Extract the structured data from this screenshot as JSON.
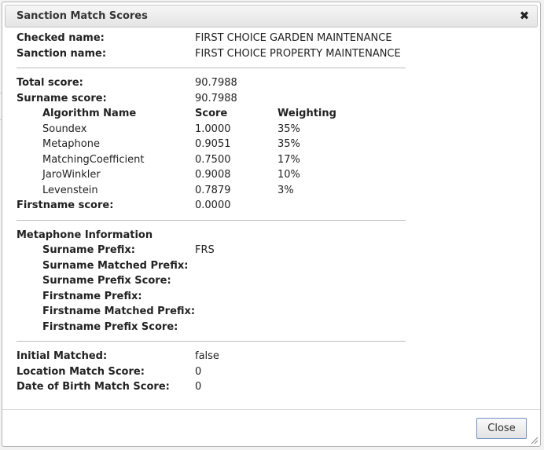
{
  "dialog": {
    "title": "Sanction Match Scores",
    "close_label": "Close"
  },
  "names": [
    {
      "label": "Checked name:",
      "value": "FIRST CHOICE GARDEN MAINTENANCE"
    },
    {
      "label": "Sanction name:",
      "value": "FIRST CHOICE PROPERTY MAINTENANCE"
    }
  ],
  "scores": {
    "total_label": "Total score:",
    "total": "90.7988",
    "surname_label": "Surname score:",
    "surname": "90.7988",
    "firstname_label": "Firstname score:",
    "firstname": "0.0000"
  },
  "algorithms": {
    "headers": {
      "name": "Algorithm Name",
      "score": "Score",
      "weighting": "Weighting"
    },
    "rows": [
      {
        "name": "Soundex",
        "score": "1.0000",
        "weighting": "35%"
      },
      {
        "name": "Metaphone",
        "score": "0.9051",
        "weighting": "35%"
      },
      {
        "name": "MatchingCoefficient",
        "score": "0.7500",
        "weighting": "17%"
      },
      {
        "name": "JaroWinkler",
        "score": "0.9008",
        "weighting": "10%"
      },
      {
        "name": "Levenstein",
        "score": "0.7879",
        "weighting": "3%"
      }
    ]
  },
  "metaphone": {
    "heading": "Metaphone Information",
    "rows": [
      {
        "label": "Surname Prefix:",
        "value": "FRS"
      },
      {
        "label": "Surname Matched Prefix:",
        "value": ""
      },
      {
        "label": "Surname Prefix Score:",
        "value": ""
      },
      {
        "label": "Firstname Prefix:",
        "value": ""
      },
      {
        "label": "Firstname Matched Prefix:",
        "value": ""
      },
      {
        "label": "Firstname Prefix Score:",
        "value": ""
      }
    ]
  },
  "other": [
    {
      "label": "Initial Matched:",
      "value": "false"
    },
    {
      "label": "Location Match Score:",
      "value": "0"
    },
    {
      "label": "Date of Birth Match Score:",
      "value": "0"
    }
  ]
}
